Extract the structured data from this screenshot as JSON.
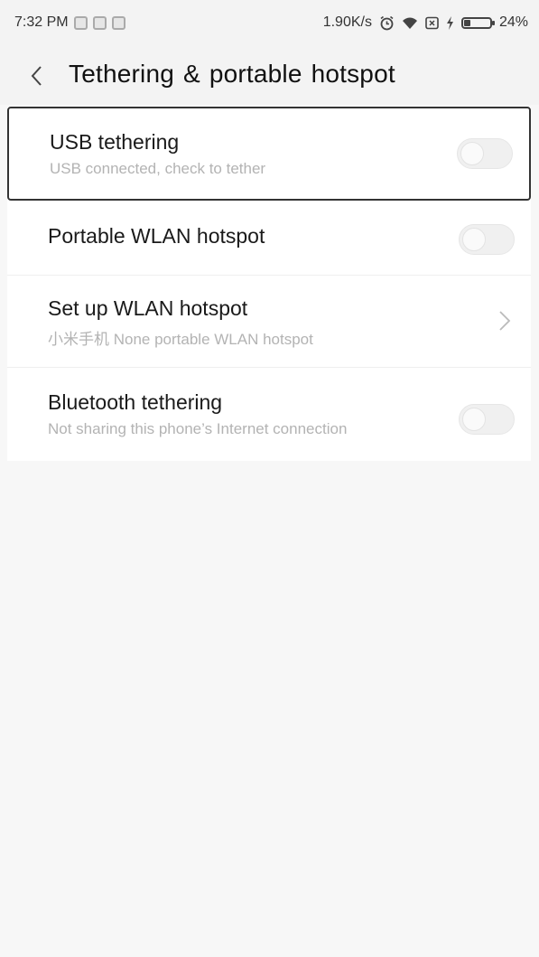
{
  "status_bar": {
    "time": "7:32 PM",
    "network_speed": "1.90K/s",
    "battery_percent": "24%",
    "battery_level": 0.24,
    "icons": [
      "notification-icon",
      "notification-icon",
      "notification-icon",
      "alarm-icon",
      "wifi-icon",
      "sim-icon",
      "charging-icon",
      "battery-icon"
    ]
  },
  "header": {
    "title": "Tethering & portable hotspot",
    "back_icon": "chevron-left-icon"
  },
  "settings": {
    "usb": {
      "title": "USB tethering",
      "subtitle": "USB connected, check to tether",
      "enabled": false
    },
    "portable_wlan": {
      "title": "Portable WLAN hotspot",
      "enabled": false
    },
    "setup_wlan": {
      "title": "Set up WLAN hotspot",
      "subtitle": "小米手机 None portable WLAN hotspot",
      "icon": "chevron-right-icon"
    },
    "bluetooth": {
      "title": "Bluetooth tethering",
      "subtitle": "Not sharing this phone’s Internet connection",
      "enabled": false
    }
  },
  "colors": {
    "background": "#f7f7f7",
    "header": "#f3f3f3",
    "subtitle_text": "#b3b3b3",
    "toggle_off": "#f0f0f0"
  }
}
